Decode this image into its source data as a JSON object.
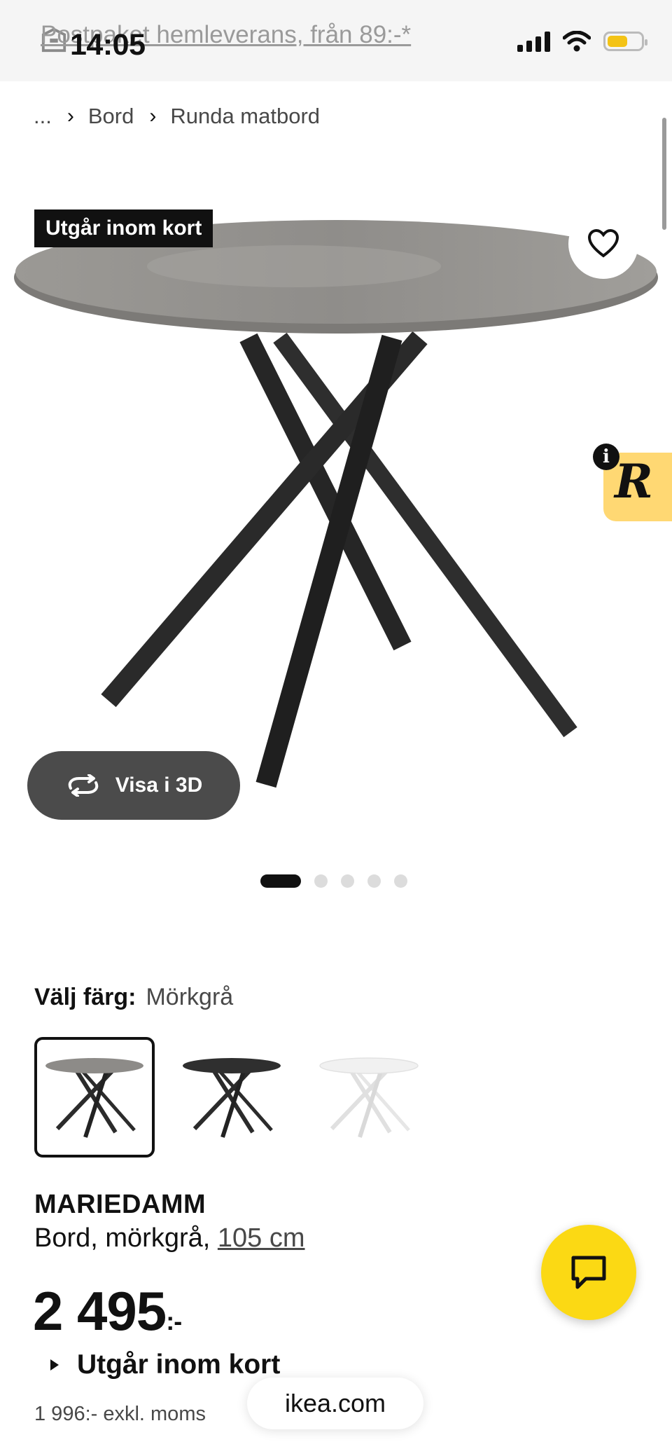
{
  "status_bar": {
    "time": "14:05",
    "battery_level": 0.6,
    "accent": "#f3c316"
  },
  "promo": {
    "text": "Postpaket hemleverans, från 89:-*",
    "icon": "package-icon"
  },
  "breadcrumb": {
    "items": [
      {
        "label": "..."
      },
      {
        "label": "Bord"
      },
      {
        "label": "Runda matbord"
      }
    ],
    "separator_icon": "chevron-right-icon"
  },
  "hero": {
    "badge": "Utgår inom kort",
    "favorite_icon": "heart-icon",
    "view_3d_label": "Visa i 3D",
    "view_3d_icon": "rotate-icon",
    "image_count": 5,
    "active_image_index": 0
  },
  "r_widget": {
    "letter": "R",
    "info": "i",
    "color": "#ffd873"
  },
  "color_picker": {
    "label": "Välj färg:",
    "selected": "Mörkgrå",
    "options": [
      {
        "name": "Mörkgrå",
        "top": "#8d8b88",
        "legs": "#2b2b2b"
      },
      {
        "name": "Svart",
        "top": "#2f2f2f",
        "legs": "#2b2b2b"
      },
      {
        "name": "Vit",
        "top": "#f1f1f1",
        "legs": "#e6e6e6"
      }
    ]
  },
  "product": {
    "name": "MARIEDAMM",
    "description": "Bord, mörkgrå,",
    "size": "105 cm",
    "price": "2 495",
    "price_suffix": ":-",
    "availability": "Utgår inom kort",
    "price_excl_vat": "1 996:- exkl. moms"
  },
  "chat": {
    "icon": "chat-bubble-icon",
    "color": "#fbd914"
  },
  "browser": {
    "domain": "ikea.com"
  }
}
